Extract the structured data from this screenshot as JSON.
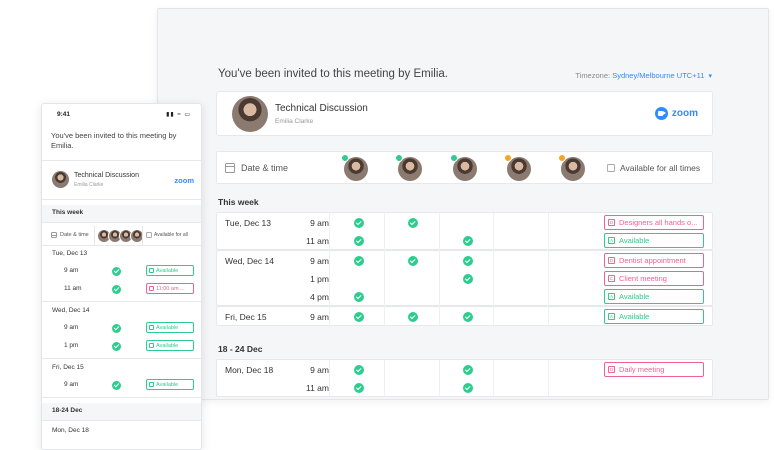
{
  "colors": {
    "accent": "#2d8cff",
    "available": "#2ecc8f",
    "busy": "#f06292",
    "pending": "#f5a623"
  },
  "desktop": {
    "invite_text": "You've been invited to this meeting by Emilia.",
    "timezone_label": "Timezone:",
    "timezone_value": "Sydney/Melbourne UTC+11",
    "meeting_title": "Technical Discussion",
    "organizer": "Emilia Clarke",
    "zoom_label": "zoom",
    "header": {
      "date_time": "Date & time",
      "available_all": "Available for all times"
    },
    "sections": [
      {
        "label": "This week",
        "days": [
          {
            "day": "Tue, Dec 13",
            "rows": [
              {
                "time": "9 am",
                "checks": [
                  true,
                  true,
                  false,
                  false,
                  false
                ],
                "tag": "Designers all hands o...",
                "tag_type": "busy",
                "tag_icon": "D"
              },
              {
                "time": "11 am",
                "checks": [
                  true,
                  false,
                  true,
                  false,
                  false
                ],
                "tag": "Available",
                "tag_type": "available",
                "tag_icon": "A"
              }
            ]
          },
          {
            "day": "Wed, Dec 14",
            "rows": [
              {
                "time": "9 am",
                "checks": [
                  true,
                  true,
                  true,
                  false,
                  false
                ],
                "tag": "Dentist appointment",
                "tag_type": "busy",
                "tag_icon": "D"
              },
              {
                "time": "1 pm",
                "checks": [
                  false,
                  false,
                  true,
                  false,
                  false
                ],
                "tag": "Client meeting",
                "tag_type": "busy",
                "tag_icon": "C"
              },
              {
                "time": "4 pm",
                "checks": [
                  true,
                  false,
                  false,
                  false,
                  false
                ],
                "tag": "Available",
                "tag_type": "available",
                "tag_icon": "A"
              }
            ]
          },
          {
            "day": "Fri, Dec 15",
            "rows": [
              {
                "time": "9 am",
                "checks": [
                  true,
                  true,
                  true,
                  false,
                  false
                ],
                "tag": "Available",
                "tag_type": "available",
                "tag_icon": "A"
              }
            ]
          }
        ]
      },
      {
        "label": "18 - 24 Dec",
        "days": [
          {
            "day": "Mon, Dec 18",
            "rows": [
              {
                "time": "9 am",
                "checks": [
                  true,
                  false,
                  true,
                  false,
                  false
                ],
                "tag": "Daily meeting",
                "tag_type": "busy",
                "tag_icon": "D"
              },
              {
                "time": "11 am",
                "checks": [
                  true,
                  false,
                  true,
                  false,
                  false
                ],
                "tag": "",
                "tag_type": "available",
                "tag_icon": ""
              }
            ]
          }
        ]
      }
    ]
  },
  "mobile": {
    "status_time": "9:41",
    "invite_text": "You've been invited to this meeting by Emilia.",
    "meeting_title": "Technical Discussion",
    "organizer": "Emilia Clarke",
    "zoom_label": "zoom",
    "this_week_label": "This week",
    "header": {
      "date_time": "Date & time",
      "available_all": "Available for all"
    },
    "days": [
      {
        "day": "Tue, Dec 13",
        "rows": [
          {
            "time": "9 am",
            "tag": "Available",
            "tag_type": "available"
          },
          {
            "time": "11 am",
            "tag": "11:00 am ...",
            "tag_type": "busy"
          }
        ]
      },
      {
        "day": "Wed, Dec 14",
        "rows": [
          {
            "time": "9 am",
            "tag": "Available",
            "tag_type": "available"
          },
          {
            "time": "1 pm",
            "tag": "Available",
            "tag_type": "available"
          }
        ]
      },
      {
        "day": "Fri, Dec 15",
        "rows": [
          {
            "time": "9 am",
            "tag": "Available",
            "tag_type": "available"
          }
        ]
      }
    ],
    "next_week_label": "18-24 Dec",
    "next_day": "Mon, Dec 18"
  }
}
